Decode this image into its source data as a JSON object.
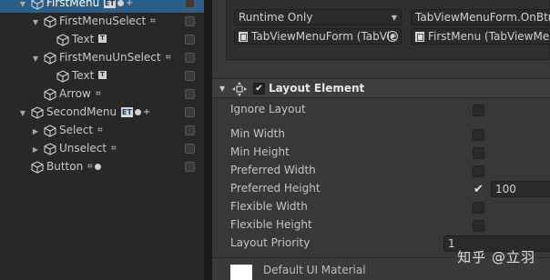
{
  "hierarchy": {
    "items": [
      {
        "label": "FirstMenu",
        "indent": 0,
        "expanded": true,
        "selected": true,
        "badges": [
          "ET",
          "dot",
          "plus"
        ]
      },
      {
        "label": "FirstMenuSelect",
        "indent": 1,
        "expanded": true,
        "selected": false,
        "badges": [
          "rt"
        ]
      },
      {
        "label": "Text",
        "indent": 2,
        "expanded": null,
        "selected": false,
        "badges": [
          "T"
        ]
      },
      {
        "label": "FirstMenuUnSelect",
        "indent": 1,
        "expanded": true,
        "selected": false,
        "badges": [
          "rt"
        ]
      },
      {
        "label": "Text",
        "indent": 2,
        "expanded": null,
        "selected": false,
        "badges": [
          "T"
        ]
      },
      {
        "label": "Arrow",
        "indent": 1,
        "expanded": null,
        "selected": false,
        "badges": [
          "rt"
        ]
      },
      {
        "label": "SecondMenu",
        "indent": 0,
        "expanded": true,
        "selected": false,
        "badges": [
          "ET",
          "dot",
          "plus"
        ]
      },
      {
        "label": "Select",
        "indent": 1,
        "expanded": false,
        "selected": false,
        "badges": [
          "rt"
        ]
      },
      {
        "label": "Unselect",
        "indent": 1,
        "expanded": false,
        "selected": false,
        "badges": [
          "rt"
        ]
      },
      {
        "label": "Button",
        "indent": -1,
        "expanded": null,
        "selected": false,
        "badges": [
          "rt",
          "dot"
        ]
      }
    ]
  },
  "event": {
    "runtime_option": "Runtime Only",
    "function_value": "TabViewMenuForm.OnBtnI",
    "object_value": "TabViewMenuForm (TabVie",
    "argument_value": "FirstMenu (TabViewMenu"
  },
  "layout_element": {
    "title": "Layout Element",
    "enabled": true,
    "properties": [
      {
        "label": "Ignore Layout",
        "checked": false,
        "value": null
      },
      {
        "label": "Min Width",
        "checked": false,
        "value": null
      },
      {
        "label": "Min Height",
        "checked": false,
        "value": null
      },
      {
        "label": "Preferred Width",
        "checked": false,
        "value": null
      },
      {
        "label": "Preferred Height",
        "checked": true,
        "value": "100"
      },
      {
        "label": "Flexible Width",
        "checked": false,
        "value": null
      },
      {
        "label": "Flexible Height",
        "checked": false,
        "value": null
      },
      {
        "label": "Layout Priority",
        "checked": null,
        "value": "1"
      }
    ]
  },
  "material": {
    "label": "Default UI Material",
    "swatch_color": "#ffffff"
  },
  "watermark": "知乎 @立羽",
  "colors": {
    "selection": "#2c5d87",
    "panel": "#383838",
    "hierarchy_bg": "#282828"
  }
}
